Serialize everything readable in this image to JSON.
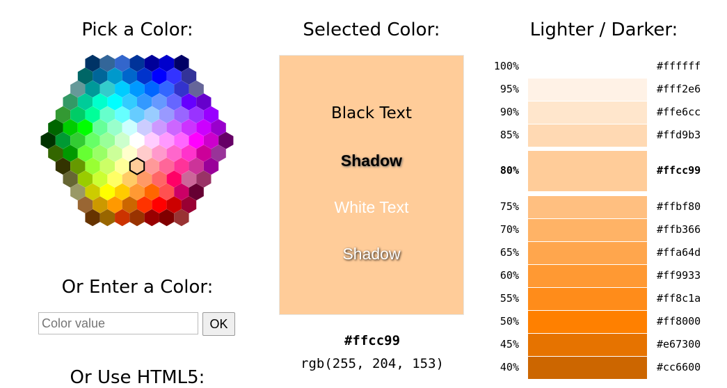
{
  "picker": {
    "title": "Pick a Color:",
    "selected_color": "#ffcc99",
    "hex_grid": [
      [
        "#003366",
        "#336699",
        "#3366cc",
        "#003399",
        "#000099",
        "#0000cc",
        "#000066"
      ],
      [
        "#006666",
        "#006699",
        "#0099cc",
        "#0066cc",
        "#0033cc",
        "#0000ff",
        "#3333ff",
        "#333399"
      ],
      [
        "#669999",
        "#009999",
        "#33cccc",
        "#00ccff",
        "#0099ff",
        "#0066ff",
        "#3366ff",
        "#3333cc",
        "#666699"
      ],
      [
        "#339966",
        "#00cc99",
        "#00ffcc",
        "#00ffff",
        "#33ccff",
        "#3399ff",
        "#6699ff",
        "#6666ff",
        "#6600ff",
        "#6600cc"
      ],
      [
        "#339933",
        "#00cc66",
        "#00ff99",
        "#66ffcc",
        "#66ffff",
        "#66ccff",
        "#99ccff",
        "#9999ff",
        "#9966ff",
        "#9933ff",
        "#9900ff"
      ],
      [
        "#006600",
        "#00cc00",
        "#00ff00",
        "#66ff99",
        "#99ffcc",
        "#ccffff",
        "#ccccff",
        "#cc99ff",
        "#cc66ff",
        "#cc33ff",
        "#cc00ff",
        "#9900cc"
      ],
      [
        "#003300",
        "#009933",
        "#33cc33",
        "#66ff66",
        "#99ff99",
        "#ccffcc",
        "#ffffff",
        "#ffccff",
        "#ff99ff",
        "#ff66ff",
        "#ff00ff",
        "#cc00cc",
        "#660066"
      ],
      [
        "#336600",
        "#009900",
        "#66ff33",
        "#99ff66",
        "#ccff99",
        "#ffffcc",
        "#ffcccc",
        "#ff99cc",
        "#ff66cc",
        "#ff33cc",
        "#cc0099",
        "#993399"
      ],
      [
        "#333300",
        "#669900",
        "#99ff33",
        "#ccff66",
        "#ffff99",
        "#ffcc99",
        "#ff9999",
        "#ff6699",
        "#ff3399",
        "#cc3399",
        "#990099"
      ],
      [
        "#666633",
        "#99cc00",
        "#ccff33",
        "#ffff66",
        "#ffcc66",
        "#ff9966",
        "#ff6666",
        "#ff0066",
        "#cc6699",
        "#993366"
      ],
      [
        "#999966",
        "#cccc00",
        "#ffff00",
        "#ffcc00",
        "#ff9933",
        "#ff6600",
        "#ff5050",
        "#cc0066",
        "#660033"
      ],
      [
        "#996633",
        "#cc9900",
        "#ff9900",
        "#cc6600",
        "#ff3300",
        "#ff0000",
        "#cc0000",
        "#990033"
      ],
      [
        "#663300",
        "#996600",
        "#cc3300",
        "#993300",
        "#990000",
        "#800000",
        "#993333"
      ]
    ]
  },
  "enter": {
    "title": "Or Enter a Color:",
    "input_value": "",
    "input_placeholder": "Color value",
    "ok_label": "OK"
  },
  "html5": {
    "title": "Or Use HTML5:"
  },
  "selected": {
    "title": "Selected Color:",
    "color": "#ffcc99",
    "black_text": "Black Text",
    "shadow_text_1": "Shadow",
    "white_text": "White Text",
    "shadow_text_2": "Shadow",
    "hex": "#ffcc99",
    "rgb": "rgb(255, 204, 153)"
  },
  "shades": {
    "title": "Lighter / Darker:",
    "rows": [
      {
        "pct": "100%",
        "hex": "#ffffff",
        "color": "#ffffff"
      },
      {
        "pct": "95%",
        "hex": "#fff2e6",
        "color": "#fff2e6"
      },
      {
        "pct": "90%",
        "hex": "#ffe6cc",
        "color": "#ffe6cc"
      },
      {
        "pct": "85%",
        "hex": "#ffd9b3",
        "color": "#ffd9b3"
      },
      {
        "pct": "80%",
        "hex": "#ffcc99",
        "color": "#ffcc99",
        "selected": true
      },
      {
        "pct": "75%",
        "hex": "#ffbf80",
        "color": "#ffbf80"
      },
      {
        "pct": "70%",
        "hex": "#ffb366",
        "color": "#ffb366"
      },
      {
        "pct": "65%",
        "hex": "#ffa64d",
        "color": "#ffa64d"
      },
      {
        "pct": "60%",
        "hex": "#ff9933",
        "color": "#ff9933"
      },
      {
        "pct": "55%",
        "hex": "#ff8c1a",
        "color": "#ff8c1a"
      },
      {
        "pct": "50%",
        "hex": "#ff8000",
        "color": "#ff8000"
      },
      {
        "pct": "45%",
        "hex": "#e67300",
        "color": "#e67300"
      },
      {
        "pct": "40%",
        "hex": "#cc6600",
        "color": "#cc6600"
      }
    ]
  }
}
